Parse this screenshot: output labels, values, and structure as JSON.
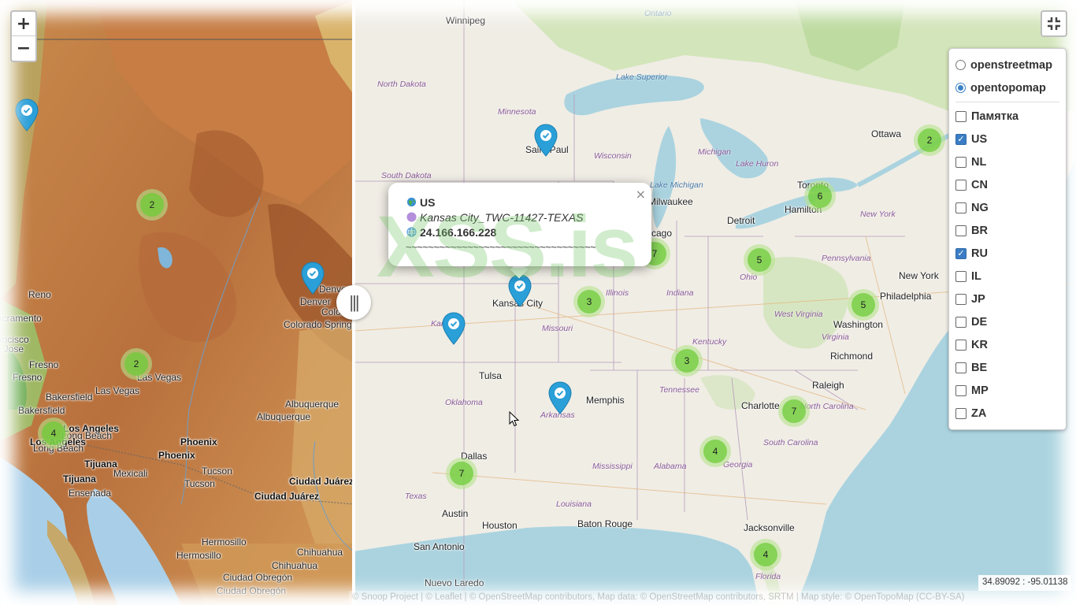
{
  "zoom": {
    "in": "+",
    "out": "−"
  },
  "divider": {
    "handle": "|||"
  },
  "layers": {
    "basemaps": [
      {
        "label": "openstreetmap",
        "selected": false
      },
      {
        "label": "opentopomap",
        "selected": true
      }
    ],
    "overlays": [
      {
        "label": "Памятка",
        "checked": false
      },
      {
        "label": "US",
        "checked": true
      },
      {
        "label": "NL",
        "checked": false
      },
      {
        "label": "CN",
        "checked": false
      },
      {
        "label": "NG",
        "checked": false
      },
      {
        "label": "BR",
        "checked": false
      },
      {
        "label": "RU",
        "checked": true
      },
      {
        "label": "IL",
        "checked": false
      },
      {
        "label": "JP",
        "checked": false
      },
      {
        "label": "DE",
        "checked": false
      },
      {
        "label": "KR",
        "checked": false
      },
      {
        "label": "BE",
        "checked": false
      },
      {
        "label": "MP",
        "checked": false
      },
      {
        "label": "ZA",
        "checked": false
      }
    ]
  },
  "popup": {
    "close": "×",
    "country": "US",
    "name": "Kansas City_TWC-11427-TEXAS",
    "ip": "24.166.166.228",
    "line": "~~~~~~~~~~~~~~~~~~~~~~~~~~~~~~~~~~"
  },
  "watermark": "XSS.is",
  "coords": "34.89092 : -95.01138",
  "attribution": {
    "text": "© Snoop Project | © Leaflet | © OpenStreetMap contributors, Map data: © OpenStreetMap contributors, SRTM | Map style: © OpenTopoMap (CC-BY-SA)"
  },
  "left_map": {
    "cities": [
      {
        "name": "Reno"
      },
      {
        "name": "Sacramento"
      },
      {
        "name": "San Francisco"
      },
      {
        "name": "San Jose"
      },
      {
        "name": "Fresno"
      },
      {
        "name": "Fresno"
      },
      {
        "name": "Bakersfield"
      },
      {
        "name": "Bakersfield"
      },
      {
        "name": "Las Vegas"
      },
      {
        "name": "Las Vegas"
      },
      {
        "name": "Los Angeles"
      },
      {
        "name": "Long Beach"
      },
      {
        "name": "Los Angeles"
      },
      {
        "name": "Long Beach"
      },
      {
        "name": "Tijuana"
      },
      {
        "name": "Tijuana"
      },
      {
        "name": "Mexicali"
      },
      {
        "name": "Ensenada"
      },
      {
        "name": "Phoenix"
      },
      {
        "name": "Phoenix"
      },
      {
        "name": "Tucson"
      },
      {
        "name": "Tucson"
      },
      {
        "name": "Albuquerque"
      },
      {
        "name": "Albuquerque"
      },
      {
        "name": "Ciudad Juárez"
      },
      {
        "name": "Ciudad Juárez"
      },
      {
        "name": "Hermosillo"
      },
      {
        "name": "Hermosillo"
      },
      {
        "name": "Chihuahua"
      },
      {
        "name": "Chihuahua"
      },
      {
        "name": "Ciudad Obregón"
      },
      {
        "name": "Ciudad Obregón"
      },
      {
        "name": "Denver"
      },
      {
        "name": "Denver"
      },
      {
        "name": "Colorado Springs"
      },
      {
        "name": "Colorado"
      }
    ],
    "clusters": [
      "2",
      "2",
      "4"
    ]
  },
  "right_map": {
    "cities": [
      {
        "name": "Winnipeg"
      },
      {
        "name": "Saint Paul"
      },
      {
        "name": "Ottawa"
      },
      {
        "name": "Toronto"
      },
      {
        "name": "Hamilton"
      },
      {
        "name": "Detroit"
      },
      {
        "name": "Milwaukee"
      },
      {
        "name": "Chicago"
      },
      {
        "name": "Kansas City"
      },
      {
        "name": "Tulsa"
      },
      {
        "name": "Memphis"
      },
      {
        "name": "Dallas"
      },
      {
        "name": "Austin"
      },
      {
        "name": "Houston"
      },
      {
        "name": "San Antonio"
      },
      {
        "name": "Baton Rouge"
      },
      {
        "name": "Nuevo Laredo"
      },
      {
        "name": "Jacksonville"
      },
      {
        "name": "Charlotte"
      },
      {
        "name": "Raleigh"
      },
      {
        "name": "Richmond"
      },
      {
        "name": "Washington"
      },
      {
        "name": "Philadelphia"
      },
      {
        "name": "New York"
      }
    ],
    "states": [
      "Minnesota",
      "North Dakota",
      "South Dakota",
      "Wisconsin",
      "Michigan",
      "Michigan",
      "Lake Huron",
      "Illinois",
      "Indiana",
      "Ohio",
      "Pennsylvania",
      "New York",
      "Missouri",
      "Kentucky",
      "West Virginia",
      "Virginia",
      "Tennessee",
      "Oklahoma",
      "Arkansas",
      "North Carolina",
      "South Carolina",
      "Mississippi",
      "Alabama",
      "Georgia",
      "Louisiana",
      "Texas",
      "Florida",
      "Kansas"
    ],
    "water": [
      "Ontario",
      "Lake Superior",
      "Lake Michigan"
    ],
    "clusters": [
      "2",
      "6",
      "5",
      "5",
      "3",
      "3",
      "7",
      "4",
      "7",
      "4",
      "7"
    ]
  }
}
